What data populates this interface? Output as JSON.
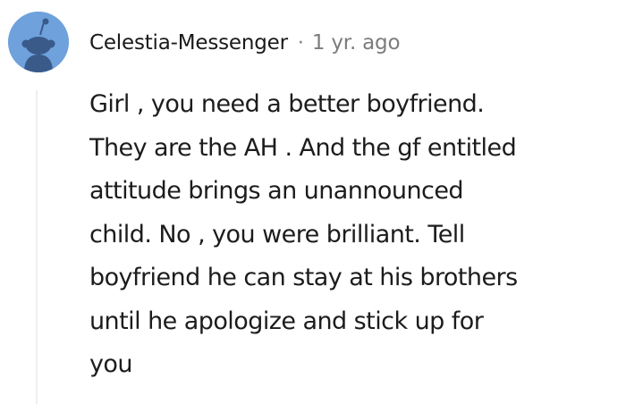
{
  "comment": {
    "author": "Celestia-Messenger",
    "separator": "·",
    "timestamp": "1 yr. ago",
    "avatar_icon": "snoo-avatar-icon",
    "avatar_color": "#6fa1dc",
    "body_lines": [
      "Girl , you need a better boyfriend.",
      "They are the AH . And the gf entitled",
      "attitude brings an unannounced",
      "child. No , you were brilliant. Tell",
      "boyfriend he can stay at his brothers",
      "until he apologize and stick up for",
      "you"
    ]
  }
}
